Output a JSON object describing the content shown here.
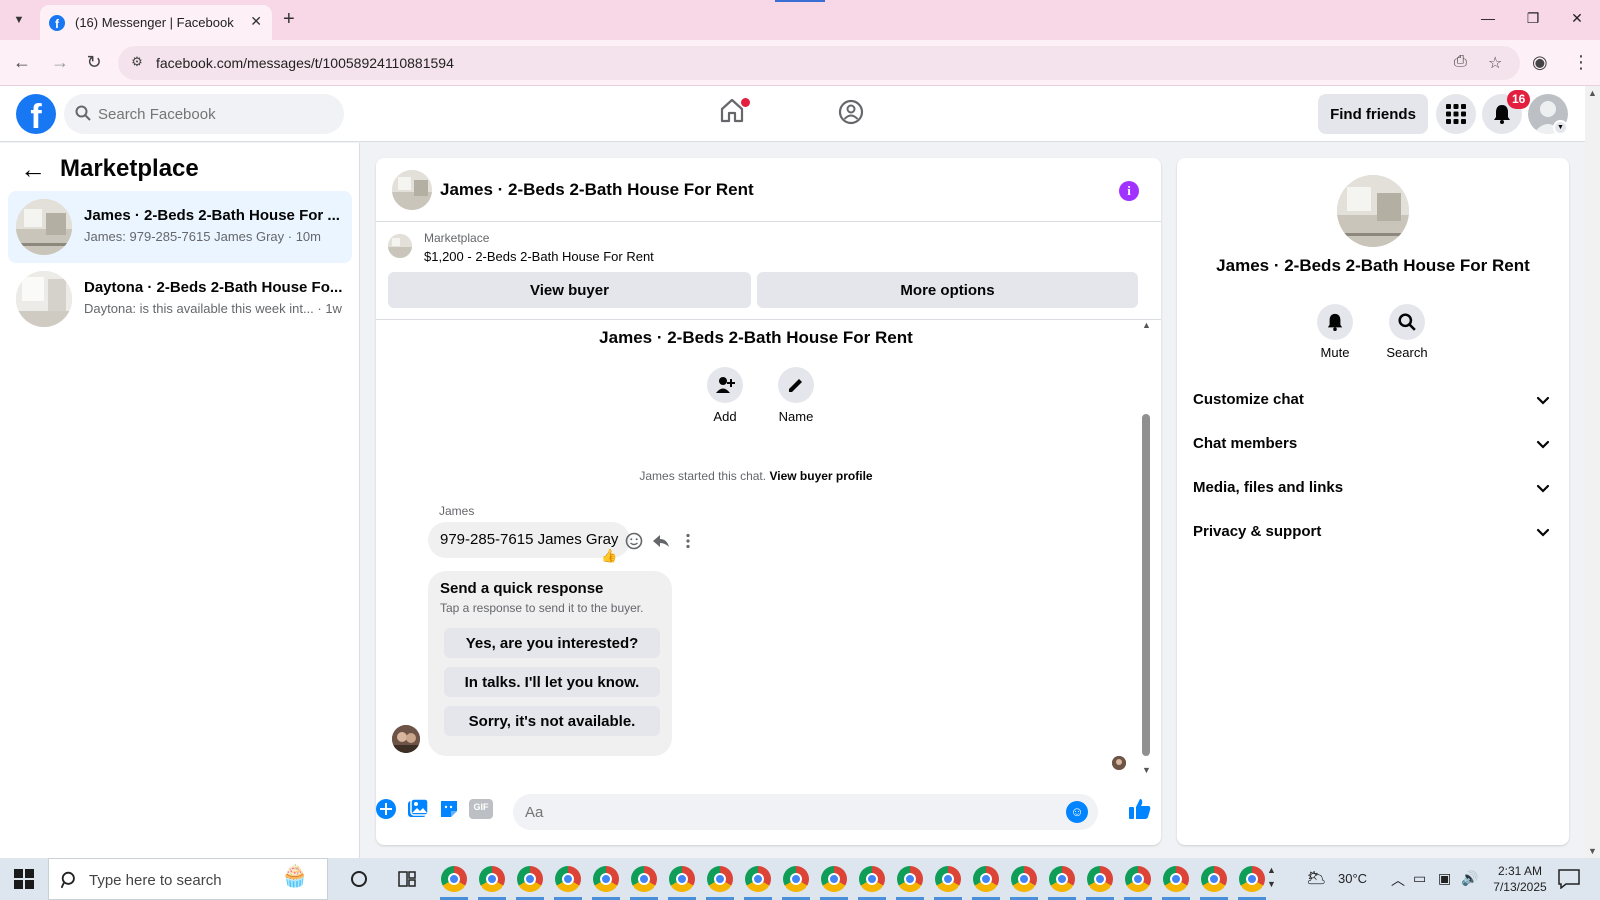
{
  "browser": {
    "tab_title": "(16) Messenger | Facebook",
    "url": "facebook.com/messages/t/10058924110881594"
  },
  "fb": {
    "search_placeholder": "Search Facebook",
    "find_friends": "Find friends",
    "notification_count": "16"
  },
  "sidebar": {
    "title": "Marketplace",
    "conversations": [
      {
        "name": "James · 2-Beds 2-Bath House For ...",
        "snippet": "James: 979-285-7615 James Gray · 10m",
        "active": true
      },
      {
        "name": "Daytona · 2-Beds 2-Bath House Fo...",
        "snippet": "Daytona: is this available this week int... · 1w",
        "active": false
      }
    ]
  },
  "chat": {
    "title": "James · 2-Beds 2-Bath House For Rent",
    "listing_source": "Marketplace",
    "listing_price": "$1,200 - 2-Beds 2-Bath House For Rent",
    "view_buyer": "View buyer",
    "more_options": "More options",
    "thread_title": "James · 2-Beds 2-Bath House For Rent",
    "add_label": "Add",
    "name_label": "Name",
    "started_text": "James started this chat.",
    "view_buyer_profile": "View buyer profile",
    "sender": "James",
    "message": "979-285-7615  James Gray",
    "reaction": "👍",
    "quick_title": "Send a quick response",
    "quick_sub": "Tap a response to send it to the buyer.",
    "quick_replies": [
      "Yes, are you interested?",
      "In talks. I'll let you know.",
      "Sorry, it's not available."
    ],
    "composer_placeholder": "Aa",
    "gif_label": "GIF"
  },
  "info": {
    "title": "James · 2-Beds 2-Bath House For Rent",
    "mute": "Mute",
    "search": "Search",
    "sections": [
      "Customize chat",
      "Chat members",
      "Media, files and links",
      "Privacy & support"
    ]
  },
  "taskbar": {
    "search_placeholder": "Type here to search",
    "temperature": "30°C",
    "time": "2:31 AM",
    "date": "7/13/2025"
  },
  "colors": {
    "fb_blue": "#1877f2",
    "messenger_blue": "#0084ff",
    "info_purple": "#a033ff",
    "badge_red": "#e41e3f",
    "active_conv_bg": "#ebf5ff"
  }
}
